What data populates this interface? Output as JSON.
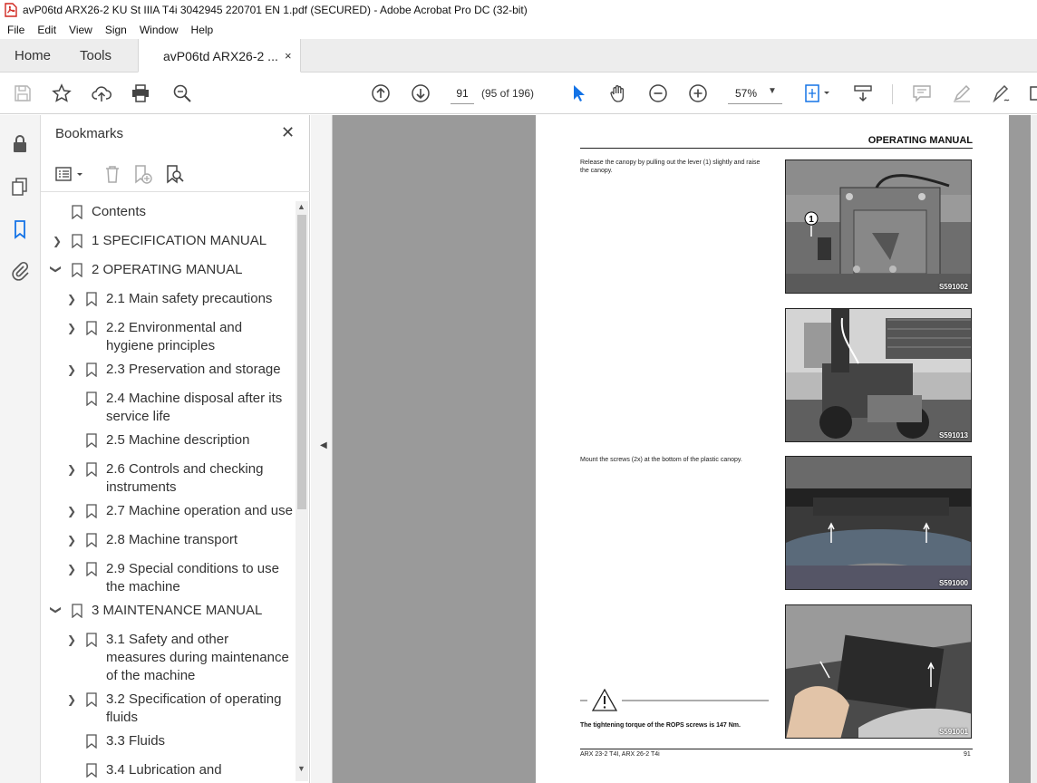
{
  "window": {
    "title": "avP06td ARX26-2 KU St IIIA T4i 3042945 220701 EN 1.pdf (SECURED) - Adobe Acrobat Pro DC (32-bit)"
  },
  "menu": [
    "File",
    "Edit",
    "View",
    "Sign",
    "Window",
    "Help"
  ],
  "tabs": {
    "home": "Home",
    "tools": "Tools",
    "document": "avP06td ARX26-2 ...",
    "close": "×"
  },
  "toolbar": {
    "page_number": "91",
    "page_total": "(95 of 196)",
    "zoom": "57%"
  },
  "bookmarks": {
    "title": "Bookmarks",
    "close": "✕",
    "items": [
      {
        "label": "Contents"
      },
      {
        "label": "1 SPECIFICATION MANUAL"
      },
      {
        "label": "2 OPERATING MANUAL"
      },
      {
        "label": "2.1 Main safety precautions"
      },
      {
        "label": "2.2 Environmental and hygiene principles"
      },
      {
        "label": "2.3 Preservation and storage"
      },
      {
        "label": "2.4 Machine disposal after its service life"
      },
      {
        "label": "2.5 Machine description"
      },
      {
        "label": "2.6 Controls and checking instruments"
      },
      {
        "label": "2.7 Machine operation and use"
      },
      {
        "label": "2.8 Machine transport"
      },
      {
        "label": "2.9 Special conditions to use the machine"
      },
      {
        "label": "3 MAINTENANCE MANUAL"
      },
      {
        "label": "3.1 Safety and other measures during maintenance of the machine"
      },
      {
        "label": "3.2 Specification of operating fluids"
      },
      {
        "label": "3.3 Fluids"
      },
      {
        "label": "3.4 Lubrication and"
      }
    ]
  },
  "pdf_page": {
    "header": "OPERATING MANUAL",
    "text1": "Release the canopy by pulling out the lever (1) slightly and raise the canopy.",
    "text2": "Mount the screws (2x) at the bottom of the plastic canopy.",
    "warning": "The tightening torque of the ROPS screws is 147 Nm.",
    "callout": "1",
    "photos": [
      "S591002",
      "S591013",
      "S591000",
      "S591001"
    ],
    "footer_left": "ARX 23-2 T4I, ARX 26-2 T4i",
    "footer_right": "91"
  }
}
